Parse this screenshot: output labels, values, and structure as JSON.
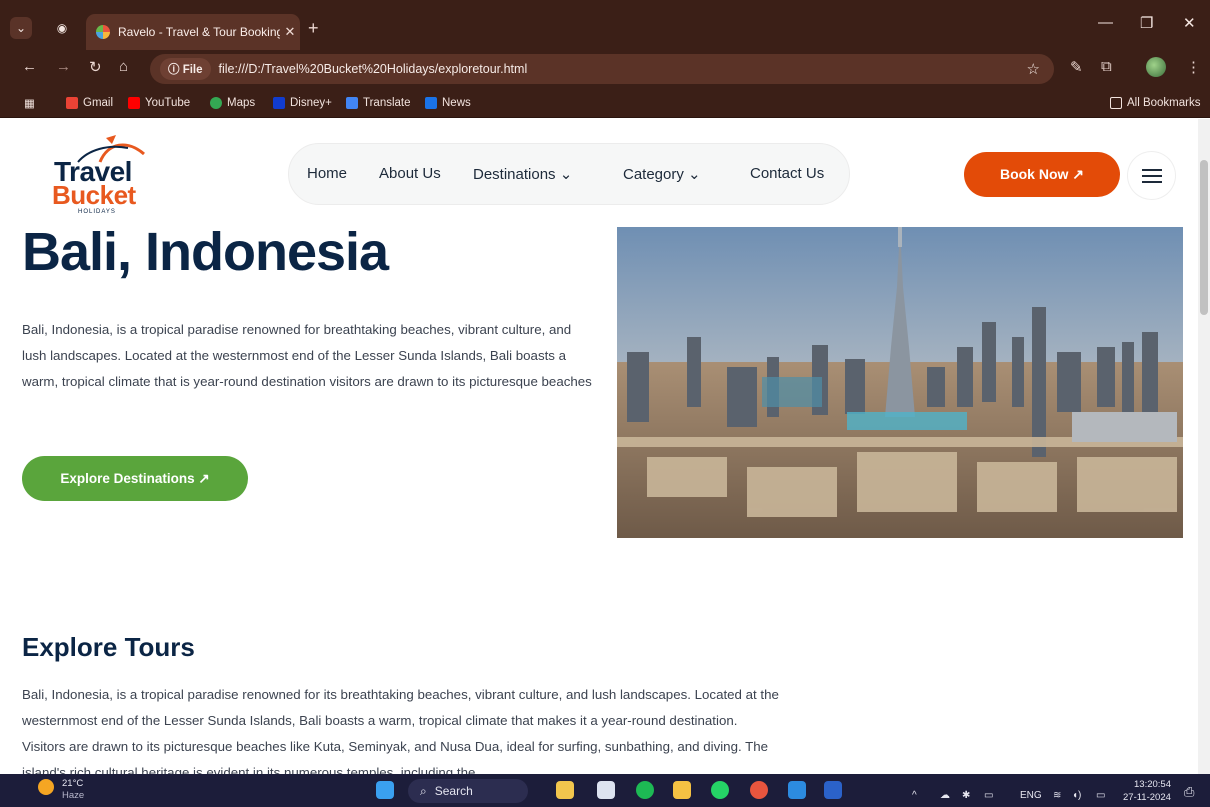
{
  "browser": {
    "tab_title": "Ravelo - Travel & Tour Booking",
    "tab_close": "✕",
    "new_tab": "+",
    "address_pill": "ⓘ File",
    "url": "file:///D:/Travel%20Bucket%20Holidays/exploretour.html",
    "bookmarks": [
      "Gmail",
      "YouTube",
      "Maps",
      "Disney+",
      "Translate",
      "News"
    ],
    "all_bookmarks": "All Bookmarks"
  },
  "site": {
    "logo": {
      "line1": "Travel",
      "line2": "Bucket",
      "line3": "HOLIDAYS"
    },
    "nav": [
      "Home",
      "About Us",
      "Destinations ⌄",
      "Category ⌄",
      "Contact Us"
    ],
    "book_now": "Book Now ↗",
    "hero_title": "Bali, Indonesia",
    "hero_text": "Bali, Indonesia, is a tropical paradise renowned for breathtaking beaches, vibrant culture, and lush landscapes. Located at the westernmost end of the Lesser Sunda Islands, Bali boasts a warm, tropical climate that is year-round destination visitors are drawn to its picturesque beaches",
    "explore_button": "Explore Destinations ↗",
    "tours_title": "Explore Tours",
    "tours_text": "Bali, Indonesia, is a tropical paradise renowned for its breathtaking beaches, vibrant culture, and lush landscapes. Located at the westernmost end of the Lesser Sunda Islands, Bali boasts a warm, tropical climate that makes it a year-round destination. Visitors are drawn to its picturesque beaches like Kuta, Seminyak, and Nusa Dua, ideal for surfing, sunbathing, and diving. The island's rich cultural heritage is evident in its numerous temples, including the"
  },
  "taskbar": {
    "weather_temp": "21°C",
    "weather_desc": "Haze",
    "search_label": "Search",
    "lang": "ENG",
    "time": "13:20:54",
    "date": "27-11-2024"
  },
  "colors": {
    "chrome": "#3b1f17",
    "brand_orange": "#e34b08",
    "brand_green": "#5aa53c",
    "heading_navy": "#0b2545"
  }
}
